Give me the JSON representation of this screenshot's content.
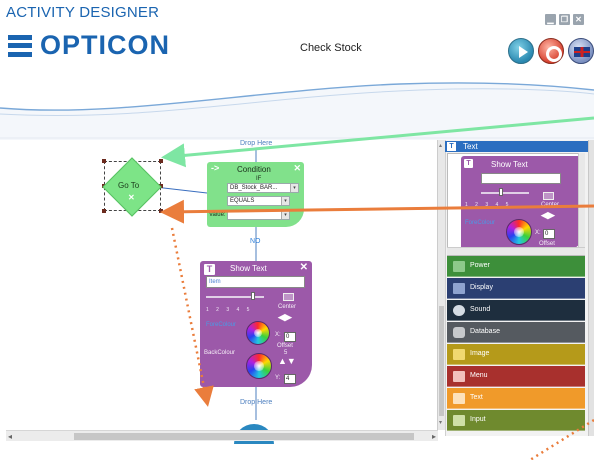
{
  "app": {
    "title": "ACTIVITY DESIGNER",
    "brand": "OPTICON",
    "document_title": "Check Stock",
    "accent_color": "#1a64b0"
  },
  "window_controls": [
    {
      "name": "minimize-icon",
      "glyph": "▁"
    },
    {
      "name": "restore-icon",
      "glyph": "❐"
    },
    {
      "name": "close-icon",
      "glyph": "✕"
    }
  ],
  "header_buttons": [
    {
      "name": "run-button",
      "icon": "play-icon"
    },
    {
      "name": "help-button",
      "icon": "lifebuoy-icon"
    },
    {
      "name": "language-button",
      "icon": "uk-flag-icon"
    }
  ],
  "canvas": {
    "drop_top": "Drop Here",
    "drop_bottom": "Drop Here",
    "no_label": "NO",
    "goto": {
      "label": "Go To",
      "close": "✕"
    },
    "condition": {
      "arrow": "->",
      "title": "Condition",
      "close": "✕",
      "if_label": "IF",
      "field": "DB_Stock_BAR...",
      "operator": "EQUALS",
      "value_label": "Value:",
      "value": ""
    },
    "show_text": {
      "icon": "T",
      "title": "Show Text",
      "close": "✕",
      "text_value": "Item",
      "ticks": "1 2 3 4 5",
      "center_label": "Center",
      "fore_colour_label": "ForeColour",
      "offset_label": "Offset",
      "offset_num": "5",
      "back_colour_label": "BackColour",
      "x_label": "X:",
      "x_value": "0",
      "y_label": "Y:",
      "y_value": "4"
    }
  },
  "palette": {
    "header": "Text",
    "header_icon": "T",
    "preview": {
      "title": "Show Text",
      "center_label": "Center",
      "fore_colour_label": "ForeColour",
      "offset_label": "Offset",
      "x_label": "X:",
      "x_value": "0",
      "ticks": "1 2 3 4 5"
    },
    "items": [
      {
        "label": "Power",
        "color": "#3d8f3a"
      },
      {
        "label": "Display",
        "color": "#2b3f72"
      },
      {
        "label": "Sound",
        "color": "#1e2e3e"
      },
      {
        "label": "Database",
        "color": "#555a60"
      },
      {
        "label": "Image",
        "color": "#b59a1a"
      },
      {
        "label": "Menu",
        "color": "#a8302d"
      },
      {
        "label": "Text",
        "color": "#f09a2a"
      },
      {
        "label": "Input",
        "color": "#6f8a2e"
      }
    ]
  },
  "colors": {
    "condition_block": "#81e18b",
    "show_text_block": "#9c59a9",
    "arrow_green": "#7ee6a3",
    "arrow_orange": "#ea7d3c"
  }
}
